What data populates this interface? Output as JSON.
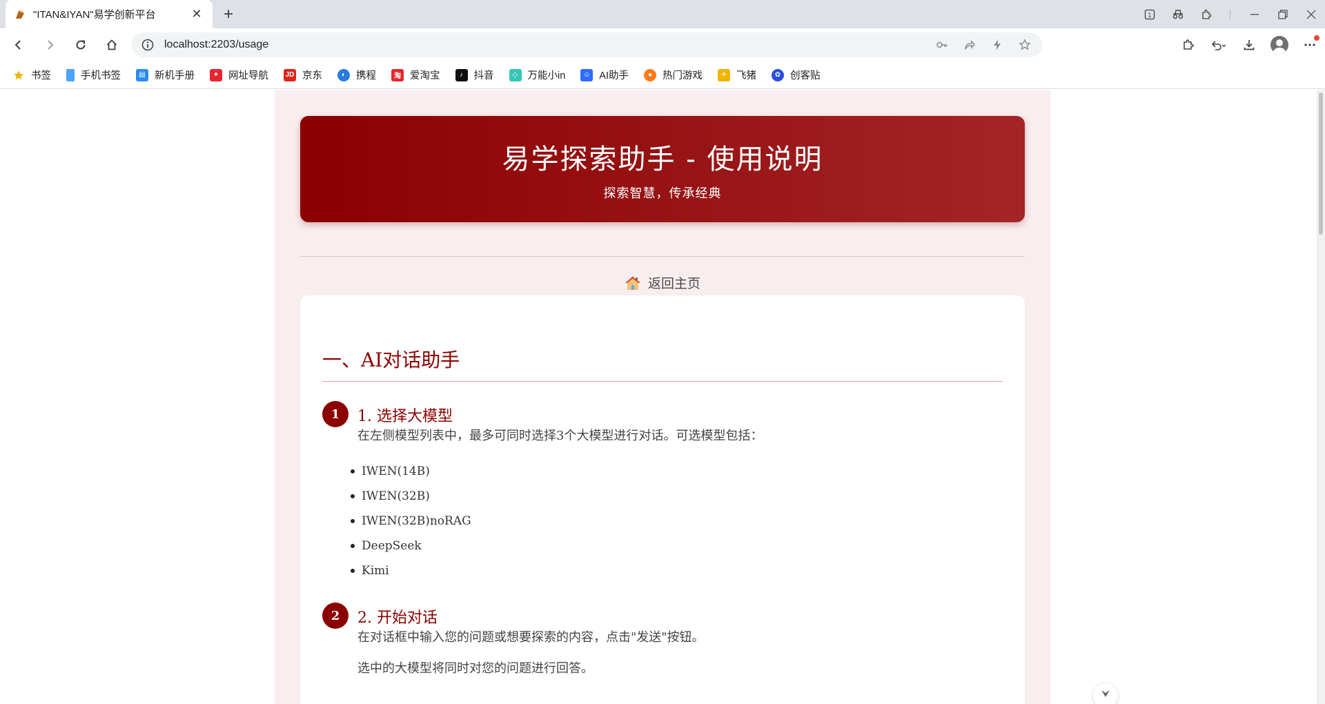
{
  "browser": {
    "tab": {
      "title": "\"ITAN&IYAN\"易学创新平台",
      "close": "✕"
    },
    "new_tab": "+",
    "url": "localhost:2203/usage",
    "bookmarks": [
      {
        "label": "书签",
        "icon": "star-icon",
        "color": "#f5b400"
      },
      {
        "label": "手机书签",
        "icon": "phone-icon",
        "color": "#4da3ff"
      },
      {
        "label": "新机手册",
        "icon": "manual-icon",
        "color": "#2a8cf0"
      },
      {
        "label": "网址导航",
        "icon": "navigation-icon",
        "color": "#e8262e"
      },
      {
        "label": "京东",
        "icon": "jd-icon",
        "color": "#e1251b"
      },
      {
        "label": "携程",
        "icon": "ctrip-icon",
        "color": "#2a7ae2"
      },
      {
        "label": "爱淘宝",
        "icon": "taobao-icon",
        "color": "#e8262e"
      },
      {
        "label": "抖音",
        "icon": "douyin-icon",
        "color": "#111111"
      },
      {
        "label": "万能小in",
        "icon": "wanneng-icon",
        "color": "#34c6b5"
      },
      {
        "label": "AI助手",
        "icon": "ai-assistant-icon",
        "color": "#2f6bff"
      },
      {
        "label": "热门游戏",
        "icon": "game-icon",
        "color": "#ff7a1a"
      },
      {
        "label": "飞猪",
        "icon": "fliggy-icon",
        "color": "#f2b400"
      },
      {
        "label": "创客贴",
        "icon": "chuangketie-icon",
        "color": "#2b4de0"
      }
    ]
  },
  "page": {
    "hero": {
      "title": "易学探索助手 - 使用说明",
      "subtitle": "探索智慧，传承经典"
    },
    "home_link": "返回主页",
    "section": {
      "title": "一、AI对话助手",
      "steps": [
        {
          "num": "1",
          "title": "1. 选择大模型",
          "text": "在左侧模型列表中，最多可同时选择3个大模型进行对话。可选模型包括：",
          "models": [
            "IWEN(14B)",
            "IWEN(32B)",
            "IWEN(32B)noRAG",
            "DeepSeek",
            "Kimi"
          ]
        },
        {
          "num": "2",
          "title": "2. 开始对话",
          "text": "在对话框中输入您的问题或想要探索的内容，点击\"发送\"按钮。",
          "text2": "选中的大模型将同时对您的问题进行回答。"
        }
      ]
    },
    "colors": {
      "primary": "#8b0000",
      "page_bg": "#f9eeef"
    }
  }
}
